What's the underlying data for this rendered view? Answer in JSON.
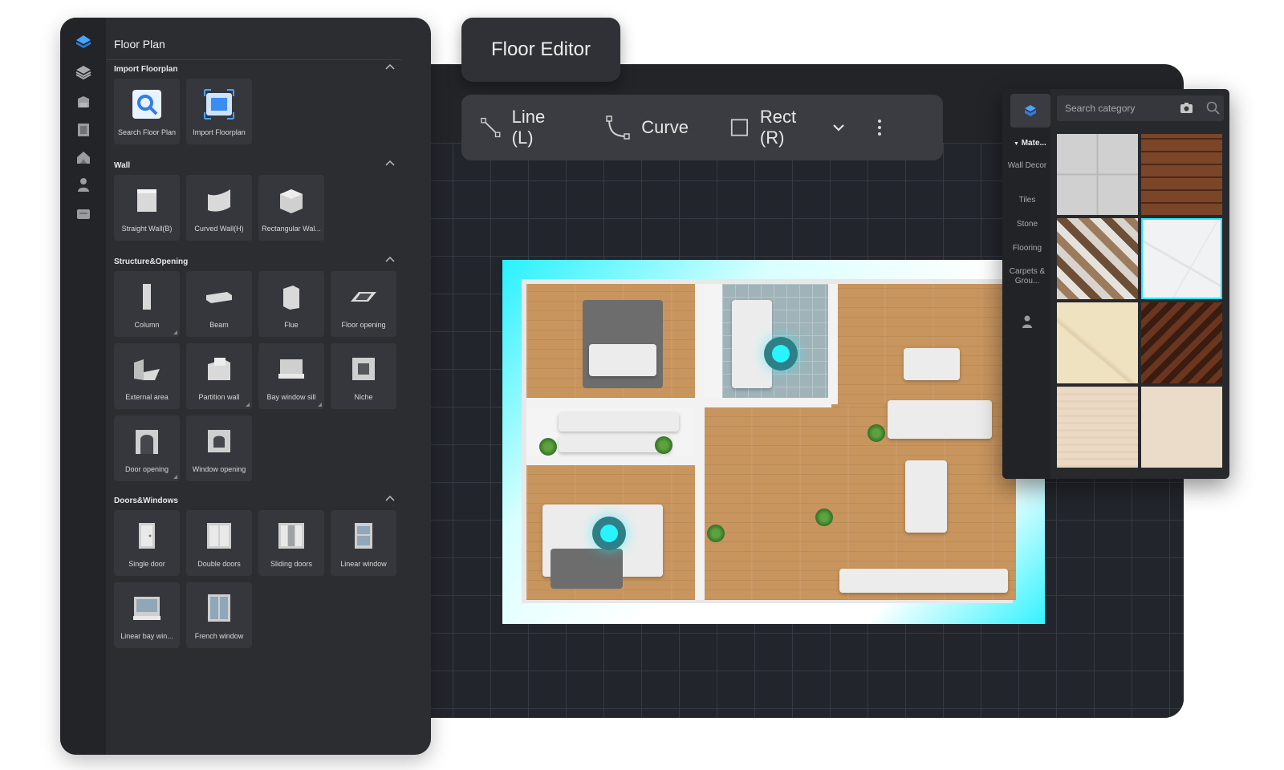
{
  "editor": {
    "title": "Floor Editor"
  },
  "draw_toolbar": {
    "tools": [
      {
        "label": "Line (L)",
        "icon": "line-tool-icon"
      },
      {
        "label": "Curve",
        "icon": "curve-tool-icon"
      },
      {
        "label": "Rect (R)",
        "icon": "rect-tool-icon"
      }
    ],
    "more_icon": "more-vertical-icon",
    "dropdown_icon": "chevron-down-icon"
  },
  "left_panel": {
    "title": "Floor Plan",
    "rail_icons": [
      "app-logo-icon",
      "layers-icon",
      "cabinet-icon",
      "door-icon",
      "house-icon",
      "person-icon",
      "box-icon"
    ],
    "sections": [
      {
        "title": "Import Floorplan",
        "items": [
          {
            "label": "Search Floor Plan"
          },
          {
            "label": "Import Floorplan"
          }
        ]
      },
      {
        "title": "Wall",
        "items": [
          {
            "label": "Straight Wall(B)"
          },
          {
            "label": "Curved Wall(H)"
          },
          {
            "label": "Rectangular Wal..."
          }
        ]
      },
      {
        "title": "Structure&Opening",
        "items": [
          {
            "label": "Column"
          },
          {
            "label": "Beam"
          },
          {
            "label": "Flue"
          },
          {
            "label": "Floor opening"
          },
          {
            "label": "External area"
          },
          {
            "label": "Partition wall"
          },
          {
            "label": "Bay window sill"
          },
          {
            "label": "Niche"
          },
          {
            "label": "Door opening"
          },
          {
            "label": "Window opening"
          }
        ]
      },
      {
        "title": "Doors&Windows",
        "items": [
          {
            "label": "Single door"
          },
          {
            "label": "Double doors"
          },
          {
            "label": "Sliding doors"
          },
          {
            "label": "Linear window"
          },
          {
            "label": "Linear bay win..."
          },
          {
            "label": "French window"
          }
        ]
      }
    ]
  },
  "materials_panel": {
    "search_placeholder": "Search category",
    "categories": [
      "Mate...",
      "Wall Decor",
      "Tiles",
      "Stone",
      "Flooring",
      "Carpets & Grou..."
    ],
    "accent": "#25e6ff"
  }
}
